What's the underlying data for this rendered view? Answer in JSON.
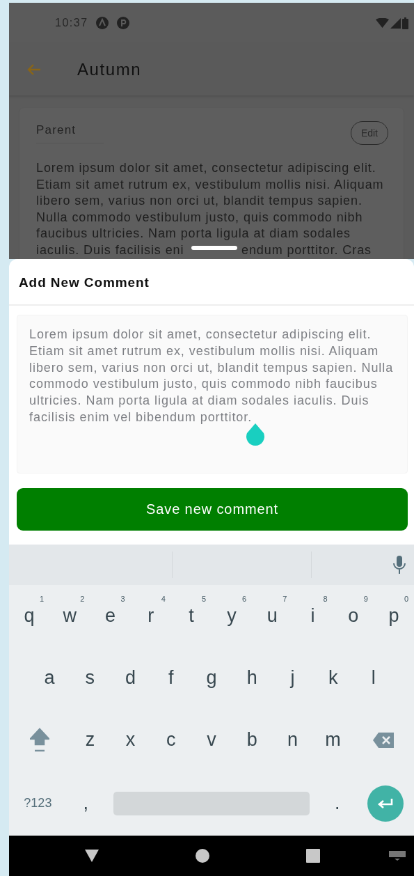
{
  "status_bar": {
    "time": "10:37"
  },
  "app_bar": {
    "title": "Autumn"
  },
  "card": {
    "label": "Parent",
    "edit_button": "Edit",
    "body_lines": [
      "Lorem ipsum dolor sit amet, consectetur adipiscing elit.",
      "Etiam sit amet rutrum ex, vestibulum mollis nisi. Aliquam",
      "libero sem, varius non orci ut, blandit tempus sapien.",
      "Nulla commodo vestibulum justo, quis commodo nibh",
      "faucibus ultricies. Nam porta ligula at diam sodales"
    ],
    "covered_line": [
      "iaculis. Duis facilisis eni",
      "endum porttitor. Cras"
    ]
  },
  "sheet": {
    "title": "Add New Comment",
    "comment": "Lorem ipsum dolor sit amet, consectetur adipiscing elit. Etiam sit amet rutrum ex, vestibulum mollis nisi. Aliquam libero sem, varius non orci ut, blandit tempus sapien. Nulla commodo vestibulum justo, quis commodo nibh faucibus ultricies. Nam porta ligula at diam sodales iaculis. Duis facilisis enim vel bibendum porttitor.",
    "save_button": "Save new comment"
  },
  "keyboard": {
    "bottom_row": {
      "symbols_key": "?123",
      "comma_key": ",",
      "period_key": "."
    },
    "letter_rows": [
      [
        {
          "kind": "char",
          "label": "q",
          "hint": "1"
        },
        {
          "kind": "char",
          "label": "w",
          "hint": "2"
        },
        {
          "kind": "char",
          "label": "e",
          "hint": "3"
        },
        {
          "kind": "char",
          "label": "r",
          "hint": "4"
        },
        {
          "kind": "char",
          "label": "t",
          "hint": "5"
        },
        {
          "kind": "char",
          "label": "y",
          "hint": "6"
        },
        {
          "kind": "char",
          "label": "u",
          "hint": "7"
        },
        {
          "kind": "char",
          "label": "i",
          "hint": "8"
        },
        {
          "kind": "char",
          "label": "o",
          "hint": "9"
        },
        {
          "kind": "char",
          "label": "p",
          "hint": "0"
        }
      ],
      [
        {
          "kind": "char",
          "label": "a"
        },
        {
          "kind": "char",
          "label": "s"
        },
        {
          "kind": "char",
          "label": "d"
        },
        {
          "kind": "char",
          "label": "f"
        },
        {
          "kind": "char",
          "label": "g"
        },
        {
          "kind": "char",
          "label": "h"
        },
        {
          "kind": "char",
          "label": "j"
        },
        {
          "kind": "char",
          "label": "k"
        },
        {
          "kind": "char",
          "label": "l"
        }
      ],
      [
        {
          "kind": "shift"
        },
        {
          "kind": "char",
          "label": "z"
        },
        {
          "kind": "char",
          "label": "x"
        },
        {
          "kind": "char",
          "label": "c"
        },
        {
          "kind": "char",
          "label": "v"
        },
        {
          "kind": "char",
          "label": "b"
        },
        {
          "kind": "char",
          "label": "n"
        },
        {
          "kind": "char",
          "label": "m"
        },
        {
          "kind": "backspace"
        }
      ]
    ]
  }
}
